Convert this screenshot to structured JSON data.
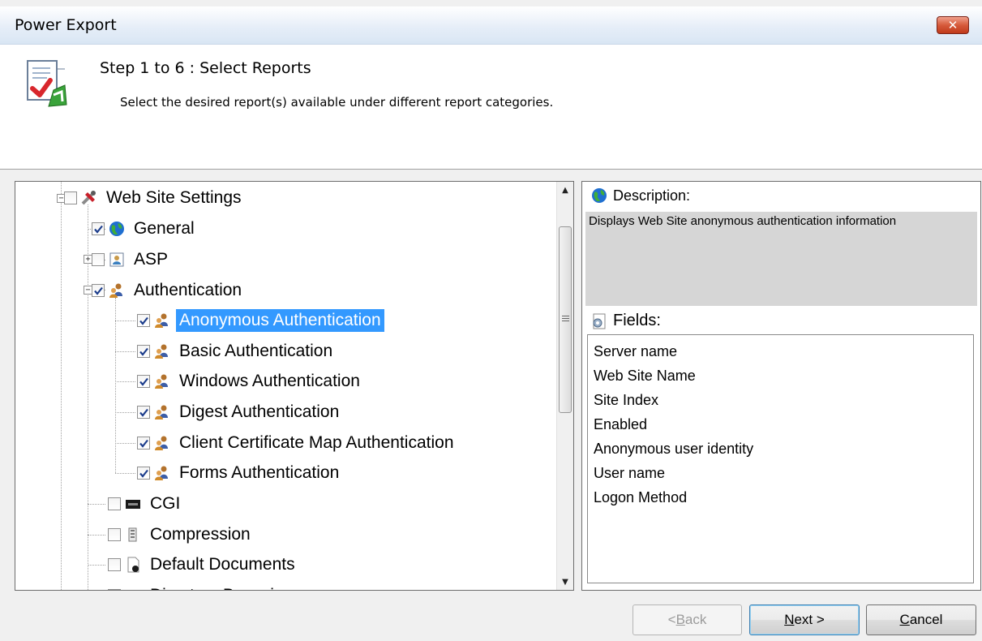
{
  "window": {
    "title": "Power Export",
    "close_glyph": "✕"
  },
  "header": {
    "step_title": "Step 1 to 6 : Select Reports",
    "step_description": "Select the desired report(s) available under different report categories.",
    "icon": "report-check-icon"
  },
  "tree": {
    "items": [
      {
        "label": "Web Site Settings",
        "checked": false,
        "expanded": true,
        "icon": "tools-icon"
      },
      {
        "label": "General",
        "checked": true,
        "icon": "globe-icon"
      },
      {
        "label": "ASP",
        "checked": false,
        "expanded": false,
        "icon": "asp-icon"
      },
      {
        "label": "Authentication",
        "checked": true,
        "expanded": true,
        "icon": "users-icon"
      },
      {
        "label": "Anonymous Authentication",
        "checked": true,
        "selected": true,
        "icon": "users-icon"
      },
      {
        "label": "Basic Authentication",
        "checked": true,
        "icon": "users-icon"
      },
      {
        "label": "Windows Authentication",
        "checked": true,
        "icon": "users-icon"
      },
      {
        "label": "Digest Authentication",
        "checked": true,
        "icon": "users-icon"
      },
      {
        "label": "Client Certificate Map Authentication",
        "checked": true,
        "icon": "users-icon"
      },
      {
        "label": "Forms Authentication",
        "checked": true,
        "icon": "users-icon"
      },
      {
        "label": "CGI",
        "checked": false,
        "icon": "cgi-icon"
      },
      {
        "label": "Compression",
        "checked": false,
        "icon": "compression-icon"
      },
      {
        "label": "Default Documents",
        "checked": false,
        "icon": "document-icon"
      },
      {
        "label": "Directory Browsing",
        "checked": false,
        "icon": "folder-icon"
      }
    ]
  },
  "description": {
    "heading": "Description:",
    "text": "Displays Web Site anonymous authentication information"
  },
  "fields": {
    "heading": "Fields:",
    "items": [
      "Server name",
      "Web Site Name",
      "Site Index",
      "Enabled",
      "Anonymous user identity",
      "User name",
      "Logon Method"
    ]
  },
  "buttons": {
    "back": {
      "prefix": "<",
      "mnemonic": "B",
      "rest": "ack"
    },
    "next": {
      "mnemonic": "N",
      "rest": "ext >"
    },
    "cancel": {
      "mnemonic": "C",
      "rest": "ancel"
    }
  },
  "colors": {
    "selection": "#3399ff",
    "close_button": "#c9452a"
  }
}
